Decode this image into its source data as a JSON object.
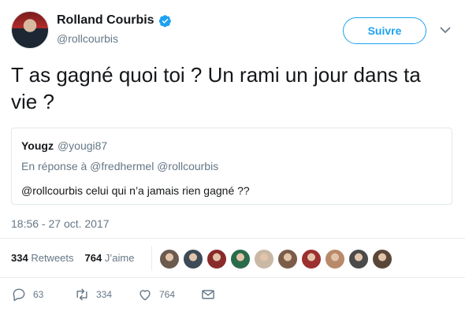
{
  "author": {
    "display_name": "Rolland Courbis",
    "handle": "@rollcourbis",
    "verified": true
  },
  "follow_button_label": "Suivre",
  "tweet_text": "T as gagné quoi toi ? Un rami un jour dans ta vie ?",
  "quoted_tweet": {
    "display_name": "Yougz",
    "handle": "@yougi87",
    "reply_context": "En réponse à @fredhermel @rollcourbis",
    "text": "@rollcourbis celui qui n’a jamais rien gagné ??"
  },
  "timestamp": "18:56 - 27 oct. 2017",
  "stats": {
    "retweets_count": "334",
    "retweets_label": "Retweets",
    "likes_count": "764",
    "likes_label": "J’aime"
  },
  "liker_avatar_colors": [
    "#6b5a4e",
    "#3d4a57",
    "#8a2b2b",
    "#2a6b4a",
    "#c9b8a6",
    "#7a5c48",
    "#9c2f2f",
    "#b88a6a",
    "#4a4a4a",
    "#5a4638"
  ],
  "actions": {
    "replies": "63",
    "retweets": "334",
    "likes": "764"
  },
  "colors": {
    "accent": "#1da1f2",
    "secondary_text": "#657786",
    "border": "#e1e8ed"
  }
}
